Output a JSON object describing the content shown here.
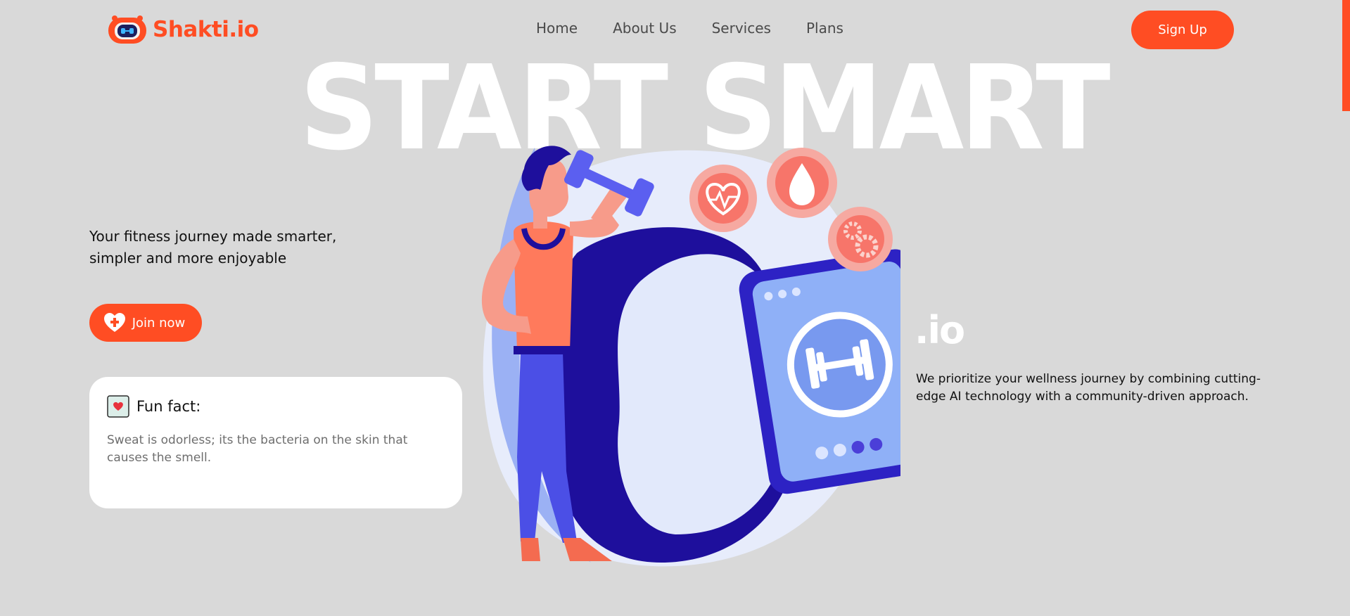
{
  "header": {
    "brand": "Shakti.io",
    "nav": [
      "Home",
      "About Us",
      "Services",
      "Plans"
    ],
    "signup_label": "Sign Up"
  },
  "hero": {
    "title": "START SMART",
    "tagline": "Your fitness journey made smarter, simpler and more enjoyable",
    "join_label": "Join now"
  },
  "fact": {
    "title": "Fun fact:",
    "text": "Sweat is odorless; its the bacteria on the skin that causes the smell."
  },
  "about": {
    "brand_suffix": ".io",
    "text": "We prioritize your wellness journey by combining cutting-edge AI technology with a community-driven approach."
  },
  "icons": {
    "logo": "robot-logo-icon",
    "join": "heart-plus-icon",
    "fact": "heart-note-icon",
    "illustration_badges": [
      "heart-pulse-icon",
      "water-drop-icon",
      "gears-icon",
      "dumbbell-icon"
    ]
  },
  "colors": {
    "accent": "#ff4d23",
    "background": "#d9d9d9",
    "card": "#ffffff",
    "watch_dark": "#1e0f9c",
    "watch_screen": "#8fb0f7",
    "badge": "#f98a7c"
  }
}
